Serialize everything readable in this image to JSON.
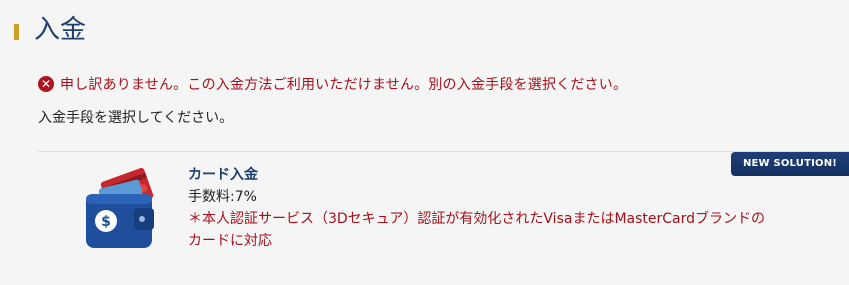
{
  "page": {
    "title": "入金"
  },
  "alert": {
    "icon": "error-x-icon",
    "color": "#b0131d",
    "message": "申し訳ありません。この入金方法ご利用いただけません。別の入金手段を選択ください。"
  },
  "instruction": "入金手段を選択してください。",
  "payment_methods": [
    {
      "icon": "wallet-card-icon",
      "badge": "NEW SOLUTION!",
      "name": "カード入金",
      "fee": "手数料:7%",
      "note_line1": "＊本人認証サービス（3Dセキュア）認証が有効化されたVisaまたはMasterCardブランドの",
      "note_line2": "カードに対応"
    }
  ],
  "colors": {
    "accent_bar": "#c9a227",
    "title": "#1d3f6e",
    "error_text": "#a4111a",
    "badge_bg": "#1f3f78"
  }
}
